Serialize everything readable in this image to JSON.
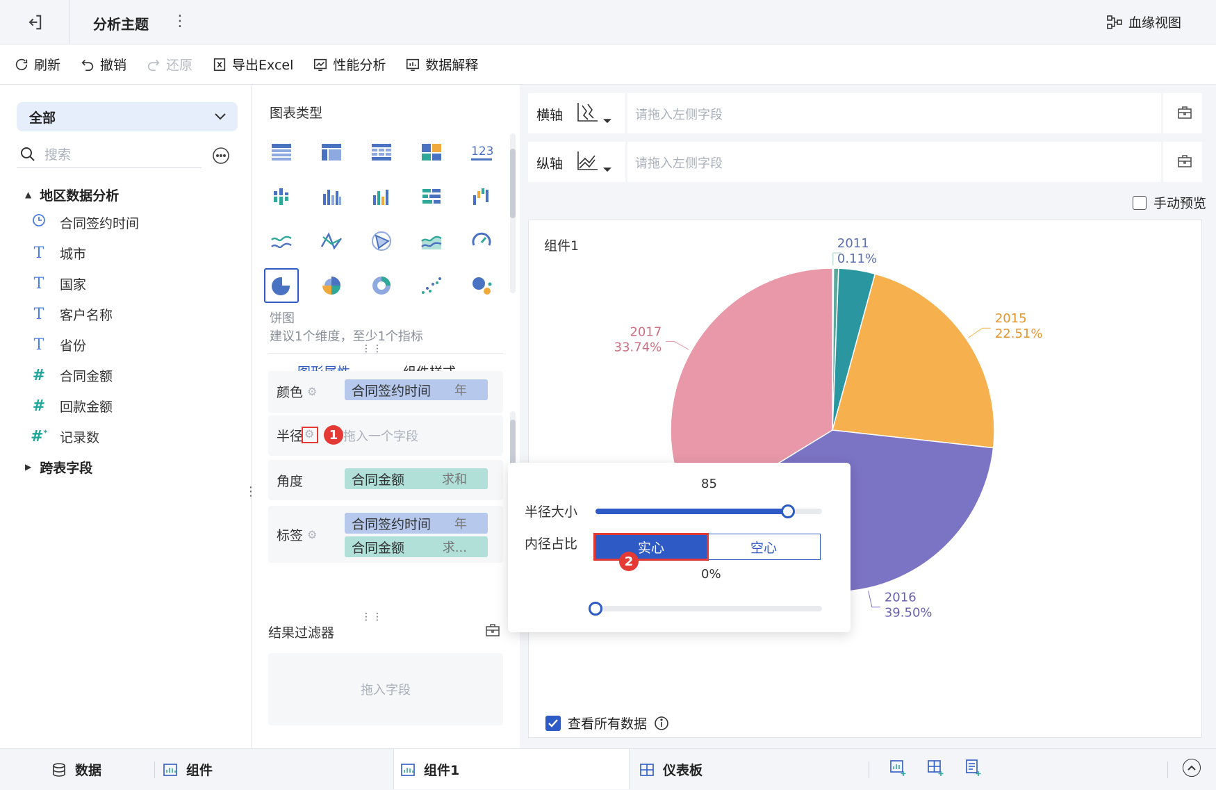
{
  "titlebar": {
    "title": "分析主题",
    "more": "⋮",
    "lineage_label": "血缘视图"
  },
  "toolbar": {
    "refresh": "刷新",
    "undo": "撤销",
    "redo": "还原",
    "export": "导出Excel",
    "perf": "性能分析",
    "explain": "数据解释"
  },
  "left": {
    "dropdown_value": "全部",
    "search_placeholder": "搜索",
    "groups": [
      {
        "label": "地区数据分析",
        "expanded": true
      },
      {
        "label": "跨表字段",
        "expanded": false
      }
    ],
    "fields": [
      {
        "icon": "clock-icon",
        "label": "合同签约时间"
      },
      {
        "icon": "text-icon",
        "label": "城市"
      },
      {
        "icon": "text-icon",
        "label": "国家"
      },
      {
        "icon": "text-icon",
        "label": "客户名称"
      },
      {
        "icon": "text-icon",
        "label": "省份"
      },
      {
        "icon": "number-icon",
        "label": "合同金额"
      },
      {
        "icon": "number-icon",
        "label": "回款金额"
      },
      {
        "icon": "number-star-icon",
        "label": "记录数"
      }
    ]
  },
  "middle": {
    "chart_type_label": "图表类型",
    "chart_name": "饼图",
    "chart_hint": "建议1个维度，至少1个指标",
    "tabs": [
      "图形属性",
      "组件样式"
    ],
    "props": {
      "color_label": "颜色",
      "color_field": "合同签约时间",
      "color_agg": "年",
      "radius_label": "半径",
      "radius_placeholder": "拖入一个字段",
      "angle_label": "角度",
      "angle_field": "合同金额",
      "angle_agg": "求和",
      "tag_label": "标签",
      "tag_field1": "合同签约时间",
      "tag_agg1": "年",
      "tag_field2": "合同金额",
      "tag_agg2": "求..."
    },
    "badge1": "1",
    "filter_label": "结果过滤器",
    "filter_placeholder": "拖入字段"
  },
  "right": {
    "x_axis_label": "横轴",
    "y_axis_label": "纵轴",
    "axis_placeholder": "请拖入左侧字段",
    "manual_preview": "手动预览",
    "card_title": "组件1",
    "view_all": "查看所有数据"
  },
  "popup": {
    "radius_value": "85",
    "radius_label": "半径大小",
    "radius_fraction": 0.85,
    "inner_label": "内径占比",
    "solid": "实心",
    "hollow": "空心",
    "inner_value": "0%",
    "inner_fraction": 0,
    "badge2": "2"
  },
  "bottom": {
    "data_tab": "数据",
    "component_tab": "组件",
    "active_tab": "组件1",
    "dashboard_tab": "仪表板"
  },
  "colors": {
    "accent": "#2d5ac4",
    "badge_red": "#e53935"
  },
  "chart_data": {
    "type": "pie",
    "title": "",
    "slices": [
      {
        "label": "2011",
        "pct_label": "0.11%",
        "value": 0.11,
        "color": "#a8d3cb"
      },
      {
        "label": "",
        "pct_label": "",
        "value": 0.5,
        "color": "#5aa89c"
      },
      {
        "label": "",
        "pct_label": "",
        "value": 3.63,
        "color": "#2a96a0"
      },
      {
        "label": "2015",
        "pct_label": "22.51%",
        "value": 22.51,
        "color": "#f6b04d"
      },
      {
        "label": "2016",
        "pct_label": "39.50%",
        "value": 39.5,
        "color": "#7b73c4"
      },
      {
        "label": "2017",
        "pct_label": "33.74%",
        "value": 33.74,
        "color": "#e898a8"
      }
    ]
  }
}
